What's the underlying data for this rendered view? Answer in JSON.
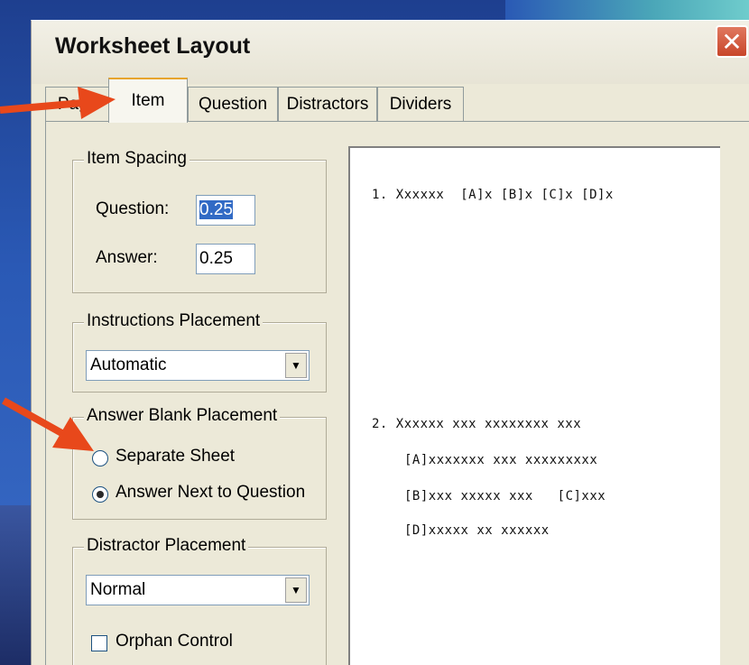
{
  "dialog": {
    "title": "Worksheet Layout",
    "close_glyph": "✕"
  },
  "tabs": [
    {
      "label": "Page",
      "active": false
    },
    {
      "label": "Item",
      "active": true
    },
    {
      "label": "Question",
      "active": false
    },
    {
      "label": "Distractors",
      "active": false
    },
    {
      "label": "Dividers",
      "active": false
    }
  ],
  "item_spacing": {
    "title": "Item Spacing",
    "question_label": "Question:",
    "question_value": "0.25",
    "answer_label": "Answer:",
    "answer_value": "0.25"
  },
  "instructions_placement": {
    "title": "Instructions Placement",
    "selected": "Automatic"
  },
  "answer_blank_placement": {
    "title": "Answer Blank Placement",
    "options": [
      {
        "label": "Separate Sheet",
        "checked": false
      },
      {
        "label": "Answer Next to Question",
        "checked": true
      }
    ]
  },
  "distractor_placement": {
    "title": "Distractor Placement",
    "selected": "Normal",
    "orphan_control_label": "Orphan Control",
    "orphan_control_checked": false
  },
  "preview": {
    "lines": [
      "1. Xxxxxx  [A]x [B]x [C]x [D]x",
      "2. Xxxxxx xxx xxxxxxxx xxx",
      "[A]xxxxxxx xxx xxxxxxxxx",
      "[B]xxx xxxxx xxx   [C]xxx",
      "[D]xxxxx xx xxxxxx"
    ]
  },
  "colors": {
    "arrow": "#e8481b",
    "dialog_bg": "#ece9d8",
    "active_tab_accent": "#e7a42d",
    "selection": "#316ac5"
  }
}
